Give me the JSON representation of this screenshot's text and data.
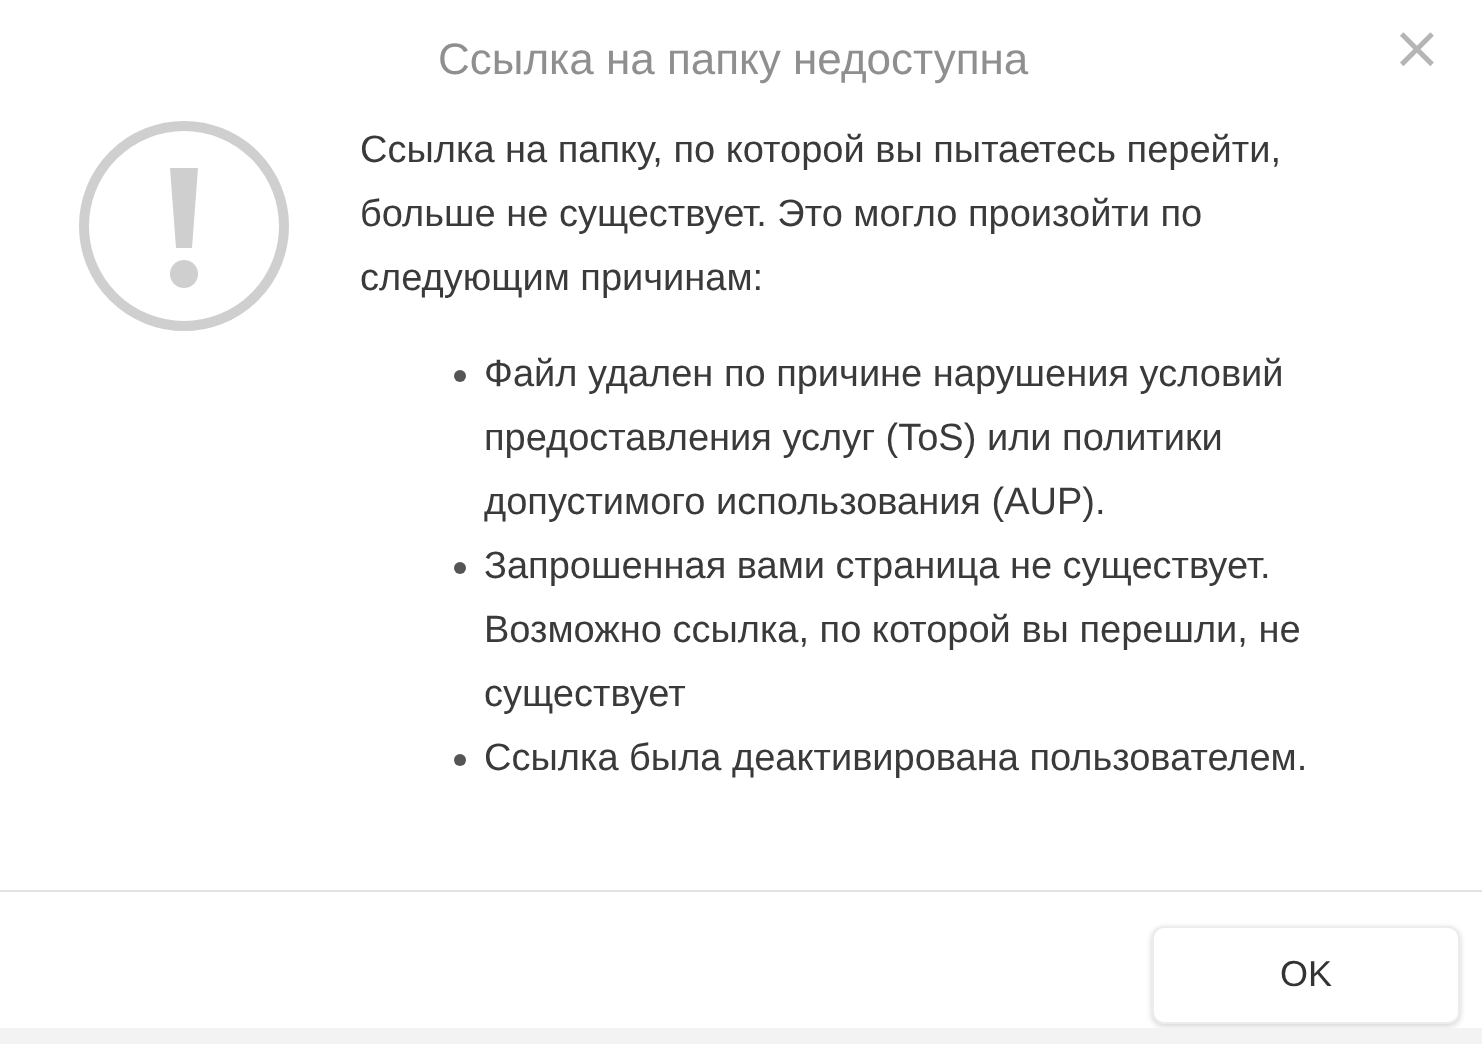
{
  "dialog": {
    "title": "Ссылка на папку недоступна",
    "close": "×",
    "message": "Ссылка на папку, по которой вы пытаетесь перейти, больше не существует. Это могло произойти по следующим причинам:",
    "reasons": [
      "Файл удален по причине нарушения условий предоставления услуг (ToS) или политики допустимого использования (AUP).",
      "Запрошенная вами страница не существует. Возможно ссылка, по которой вы перешли, не существует",
      "Ссылка была деактивирована пользователем."
    ],
    "buttons": [
      "OK"
    ]
  }
}
